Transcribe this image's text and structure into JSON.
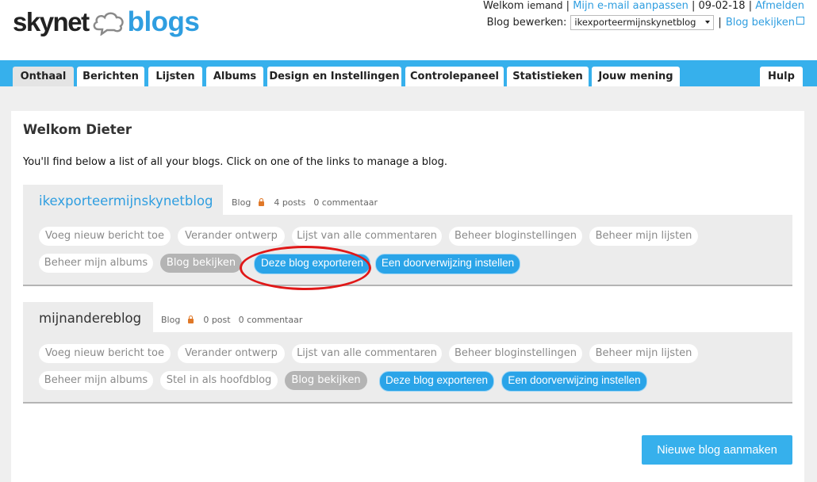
{
  "header": {
    "logo_left": "skynet",
    "logo_right": "blogs",
    "welcome_prefix": "Welkom",
    "welcome_user": "iemand",
    "sep": "|",
    "change_email": "Mijn e-mail aanpassen",
    "date": "09-02-18",
    "logout": "Afmelden",
    "edit_blog_label": "Blog bewerken:",
    "selected_blog": "ikexporteermijnskynetblog",
    "view_blog": "Blog bekijken"
  },
  "nav": {
    "tabs": [
      "Onthaal",
      "Berichten",
      "Lijsten",
      "Albums",
      "Design en Instellingen",
      "Controlepaneel",
      "Statistieken",
      "Jouw mening"
    ],
    "help": "Hulp",
    "active": "Onthaal"
  },
  "main": {
    "title": "Welkom Dieter",
    "intro": "You'll find below a list of all your blogs. Click on one of the links to manage a blog."
  },
  "blogs": [
    {
      "name": "ikexporteermijnskynetblog",
      "type": "Blog",
      "posts": "4 posts",
      "comments": "0 commentaar",
      "actions": [
        "Voeg nieuw bericht toe",
        "Verander ontwerp",
        "Lijst van alle commentaren",
        "Beheer bloginstellingen",
        "Beheer mijn lijsten",
        "Beheer mijn albums",
        "Blog bekijken",
        "Deze blog exporteren",
        "Een doorverwijzing instellen"
      ]
    },
    {
      "name": "mijnandereblog",
      "type": "Blog",
      "posts": "0 post",
      "comments": "0 commentaar",
      "actions": [
        "Voeg nieuw bericht toe",
        "Verander ontwerp",
        "Lijst van alle commentaren",
        "Beheer bloginstellingen",
        "Beheer mijn lijsten",
        "Beheer mijn albums",
        "Stel in als hoofdblog",
        "Blog bekijken",
        "Deze blog exporteren",
        "Een doorverwijzing instellen"
      ]
    }
  ],
  "new_blog_button": "Nieuwe blog aanmaken",
  "colors": {
    "accent": "#36b0ec",
    "link": "#2f9ee0",
    "highlight": "#e01818"
  }
}
